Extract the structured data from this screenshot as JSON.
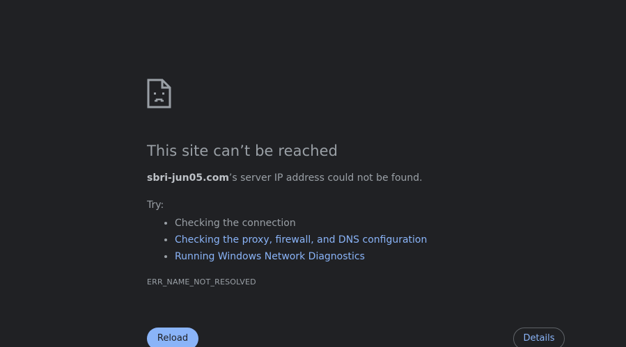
{
  "error": {
    "title": "This site can’t be reached",
    "domain": "sbri-jun05.com",
    "description_suffix": "’s server IP address could not be found.",
    "try_label": "Try:",
    "suggestions": [
      "Checking the connection",
      "Checking the proxy, firewall, and DNS configuration",
      "Running Windows Network Diagnostics"
    ],
    "code": "ERR_NAME_NOT_RESOLVED",
    "icon": "sad-document-icon"
  },
  "buttons": {
    "reload_label": "Reload",
    "details_label": "Details"
  },
  "colors": {
    "background": "#202124",
    "text": "#9aa0a6",
    "link": "#8ab4f8",
    "button_fill": "#8ab4f8"
  }
}
